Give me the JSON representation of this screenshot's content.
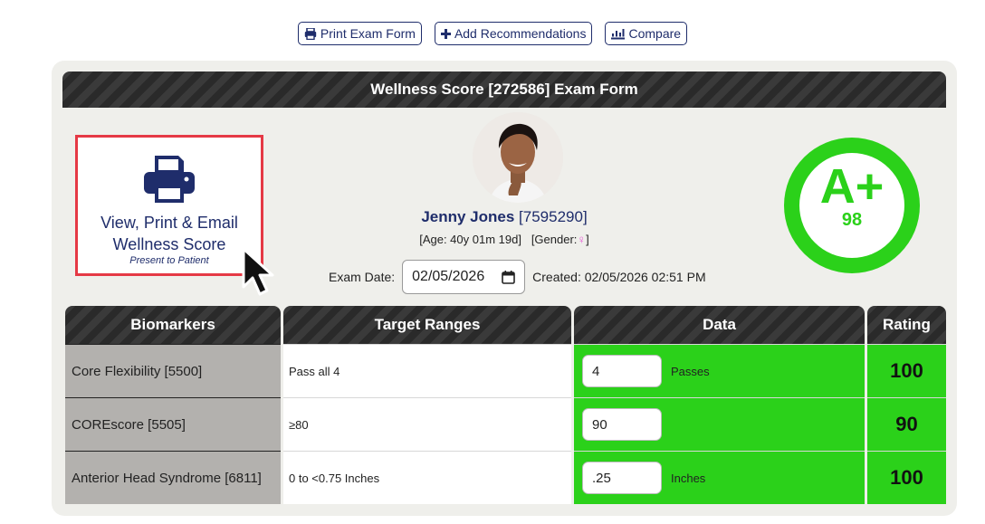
{
  "toolbar": {
    "print_label": "Print Exam Form",
    "add_label": "Add Recommendations",
    "compare_label": "Compare"
  },
  "form": {
    "title": "Wellness Score [272586] Exam Form"
  },
  "print_card": {
    "line1": "View, Print & Email",
    "line2": "Wellness Score",
    "subtitle": "Present to Patient"
  },
  "patient": {
    "name": "Jenny Jones",
    "id": "[7595290]",
    "age": "[Age: 40y 01m 19d]",
    "gender_label": "[Gender:",
    "gender_symbol": "♀",
    "gender_close": "]"
  },
  "exam": {
    "date_label": "Exam Date:",
    "date_value": "02/05/2026",
    "created": "Created: 02/05/2026 02:51 PM"
  },
  "grade": {
    "letter": "A+",
    "score": "98",
    "color": "#2bd11a"
  },
  "table": {
    "headers": [
      "Biomarkers",
      "Target Ranges",
      "Data",
      "Rating"
    ],
    "rows": [
      {
        "biomarker": "Core Flexibility [5500]",
        "target": "Pass all 4",
        "value": "4",
        "unit": "Passes",
        "rating": "100"
      },
      {
        "biomarker": "COREscore [5505]",
        "target": "≥80",
        "value": "90",
        "unit": "",
        "rating": "90"
      },
      {
        "biomarker": "Anterior Head Syndrome [6811]",
        "target": "0 to <0.75 Inches",
        "value": ".25",
        "unit": "Inches",
        "rating": "100"
      }
    ]
  },
  "colors": {
    "accent": "#1f2d6b",
    "good": "#2bd11a",
    "highlight": "#e53945"
  }
}
